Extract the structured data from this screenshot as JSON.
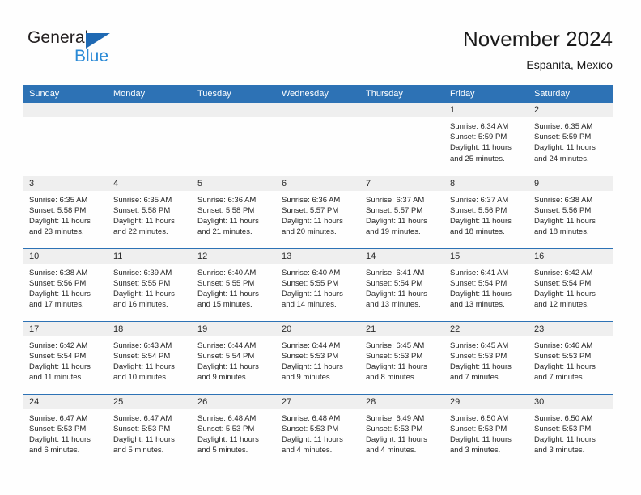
{
  "brand": {
    "name_part1": "General",
    "name_part2": "Blue",
    "triangle_color": "#1f69b3",
    "blue_color": "#2b8ad6"
  },
  "header": {
    "title": "November 2024",
    "subtitle": "Espanita, Mexico"
  },
  "theme": {
    "header_bg": "#2d72b5",
    "daynum_bg": "#efefef",
    "row_divider": "#2d72b5",
    "page_bg": "#fefefe",
    "text": "#262626"
  },
  "weekday_headers": [
    "Sunday",
    "Monday",
    "Tuesday",
    "Wednesday",
    "Thursday",
    "Friday",
    "Saturday"
  ],
  "labels": {
    "sunrise_prefix": "Sunrise:",
    "sunset_prefix": "Sunset:",
    "daylight_prefix": "Daylight:"
  },
  "weeks": [
    [
      {
        "day": "",
        "blank": true
      },
      {
        "day": "",
        "blank": true
      },
      {
        "day": "",
        "blank": true
      },
      {
        "day": "",
        "blank": true
      },
      {
        "day": "",
        "blank": true
      },
      {
        "day": "1",
        "sunrise": "Sunrise: 6:34 AM",
        "sunset": "Sunset: 5:59 PM",
        "daylight_line1": "Daylight: 11 hours",
        "daylight_line2": "and 25 minutes."
      },
      {
        "day": "2",
        "sunrise": "Sunrise: 6:35 AM",
        "sunset": "Sunset: 5:59 PM",
        "daylight_line1": "Daylight: 11 hours",
        "daylight_line2": "and 24 minutes."
      }
    ],
    [
      {
        "day": "3",
        "sunrise": "Sunrise: 6:35 AM",
        "sunset": "Sunset: 5:58 PM",
        "daylight_line1": "Daylight: 11 hours",
        "daylight_line2": "and 23 minutes."
      },
      {
        "day": "4",
        "sunrise": "Sunrise: 6:35 AM",
        "sunset": "Sunset: 5:58 PM",
        "daylight_line1": "Daylight: 11 hours",
        "daylight_line2": "and 22 minutes."
      },
      {
        "day": "5",
        "sunrise": "Sunrise: 6:36 AM",
        "sunset": "Sunset: 5:58 PM",
        "daylight_line1": "Daylight: 11 hours",
        "daylight_line2": "and 21 minutes."
      },
      {
        "day": "6",
        "sunrise": "Sunrise: 6:36 AM",
        "sunset": "Sunset: 5:57 PM",
        "daylight_line1": "Daylight: 11 hours",
        "daylight_line2": "and 20 minutes."
      },
      {
        "day": "7",
        "sunrise": "Sunrise: 6:37 AM",
        "sunset": "Sunset: 5:57 PM",
        "daylight_line1": "Daylight: 11 hours",
        "daylight_line2": "and 19 minutes."
      },
      {
        "day": "8",
        "sunrise": "Sunrise: 6:37 AM",
        "sunset": "Sunset: 5:56 PM",
        "daylight_line1": "Daylight: 11 hours",
        "daylight_line2": "and 18 minutes."
      },
      {
        "day": "9",
        "sunrise": "Sunrise: 6:38 AM",
        "sunset": "Sunset: 5:56 PM",
        "daylight_line1": "Daylight: 11 hours",
        "daylight_line2": "and 18 minutes."
      }
    ],
    [
      {
        "day": "10",
        "sunrise": "Sunrise: 6:38 AM",
        "sunset": "Sunset: 5:56 PM",
        "daylight_line1": "Daylight: 11 hours",
        "daylight_line2": "and 17 minutes."
      },
      {
        "day": "11",
        "sunrise": "Sunrise: 6:39 AM",
        "sunset": "Sunset: 5:55 PM",
        "daylight_line1": "Daylight: 11 hours",
        "daylight_line2": "and 16 minutes."
      },
      {
        "day": "12",
        "sunrise": "Sunrise: 6:40 AM",
        "sunset": "Sunset: 5:55 PM",
        "daylight_line1": "Daylight: 11 hours",
        "daylight_line2": "and 15 minutes."
      },
      {
        "day": "13",
        "sunrise": "Sunrise: 6:40 AM",
        "sunset": "Sunset: 5:55 PM",
        "daylight_line1": "Daylight: 11 hours",
        "daylight_line2": "and 14 minutes."
      },
      {
        "day": "14",
        "sunrise": "Sunrise: 6:41 AM",
        "sunset": "Sunset: 5:54 PM",
        "daylight_line1": "Daylight: 11 hours",
        "daylight_line2": "and 13 minutes."
      },
      {
        "day": "15",
        "sunrise": "Sunrise: 6:41 AM",
        "sunset": "Sunset: 5:54 PM",
        "daylight_line1": "Daylight: 11 hours",
        "daylight_line2": "and 13 minutes."
      },
      {
        "day": "16",
        "sunrise": "Sunrise: 6:42 AM",
        "sunset": "Sunset: 5:54 PM",
        "daylight_line1": "Daylight: 11 hours",
        "daylight_line2": "and 12 minutes."
      }
    ],
    [
      {
        "day": "17",
        "sunrise": "Sunrise: 6:42 AM",
        "sunset": "Sunset: 5:54 PM",
        "daylight_line1": "Daylight: 11 hours",
        "daylight_line2": "and 11 minutes."
      },
      {
        "day": "18",
        "sunrise": "Sunrise: 6:43 AM",
        "sunset": "Sunset: 5:54 PM",
        "daylight_line1": "Daylight: 11 hours",
        "daylight_line2": "and 10 minutes."
      },
      {
        "day": "19",
        "sunrise": "Sunrise: 6:44 AM",
        "sunset": "Sunset: 5:54 PM",
        "daylight_line1": "Daylight: 11 hours",
        "daylight_line2": "and 9 minutes."
      },
      {
        "day": "20",
        "sunrise": "Sunrise: 6:44 AM",
        "sunset": "Sunset: 5:53 PM",
        "daylight_line1": "Daylight: 11 hours",
        "daylight_line2": "and 9 minutes."
      },
      {
        "day": "21",
        "sunrise": "Sunrise: 6:45 AM",
        "sunset": "Sunset: 5:53 PM",
        "daylight_line1": "Daylight: 11 hours",
        "daylight_line2": "and 8 minutes."
      },
      {
        "day": "22",
        "sunrise": "Sunrise: 6:45 AM",
        "sunset": "Sunset: 5:53 PM",
        "daylight_line1": "Daylight: 11 hours",
        "daylight_line2": "and 7 minutes."
      },
      {
        "day": "23",
        "sunrise": "Sunrise: 6:46 AM",
        "sunset": "Sunset: 5:53 PM",
        "daylight_line1": "Daylight: 11 hours",
        "daylight_line2": "and 7 minutes."
      }
    ],
    [
      {
        "day": "24",
        "sunrise": "Sunrise: 6:47 AM",
        "sunset": "Sunset: 5:53 PM",
        "daylight_line1": "Daylight: 11 hours",
        "daylight_line2": "and 6 minutes."
      },
      {
        "day": "25",
        "sunrise": "Sunrise: 6:47 AM",
        "sunset": "Sunset: 5:53 PM",
        "daylight_line1": "Daylight: 11 hours",
        "daylight_line2": "and 5 minutes."
      },
      {
        "day": "26",
        "sunrise": "Sunrise: 6:48 AM",
        "sunset": "Sunset: 5:53 PM",
        "daylight_line1": "Daylight: 11 hours",
        "daylight_line2": "and 5 minutes."
      },
      {
        "day": "27",
        "sunrise": "Sunrise: 6:48 AM",
        "sunset": "Sunset: 5:53 PM",
        "daylight_line1": "Daylight: 11 hours",
        "daylight_line2": "and 4 minutes."
      },
      {
        "day": "28",
        "sunrise": "Sunrise: 6:49 AM",
        "sunset": "Sunset: 5:53 PM",
        "daylight_line1": "Daylight: 11 hours",
        "daylight_line2": "and 4 minutes."
      },
      {
        "day": "29",
        "sunrise": "Sunrise: 6:50 AM",
        "sunset": "Sunset: 5:53 PM",
        "daylight_line1": "Daylight: 11 hours",
        "daylight_line2": "and 3 minutes."
      },
      {
        "day": "30",
        "sunrise": "Sunrise: 6:50 AM",
        "sunset": "Sunset: 5:53 PM",
        "daylight_line1": "Daylight: 11 hours",
        "daylight_line2": "and 3 minutes."
      }
    ]
  ]
}
